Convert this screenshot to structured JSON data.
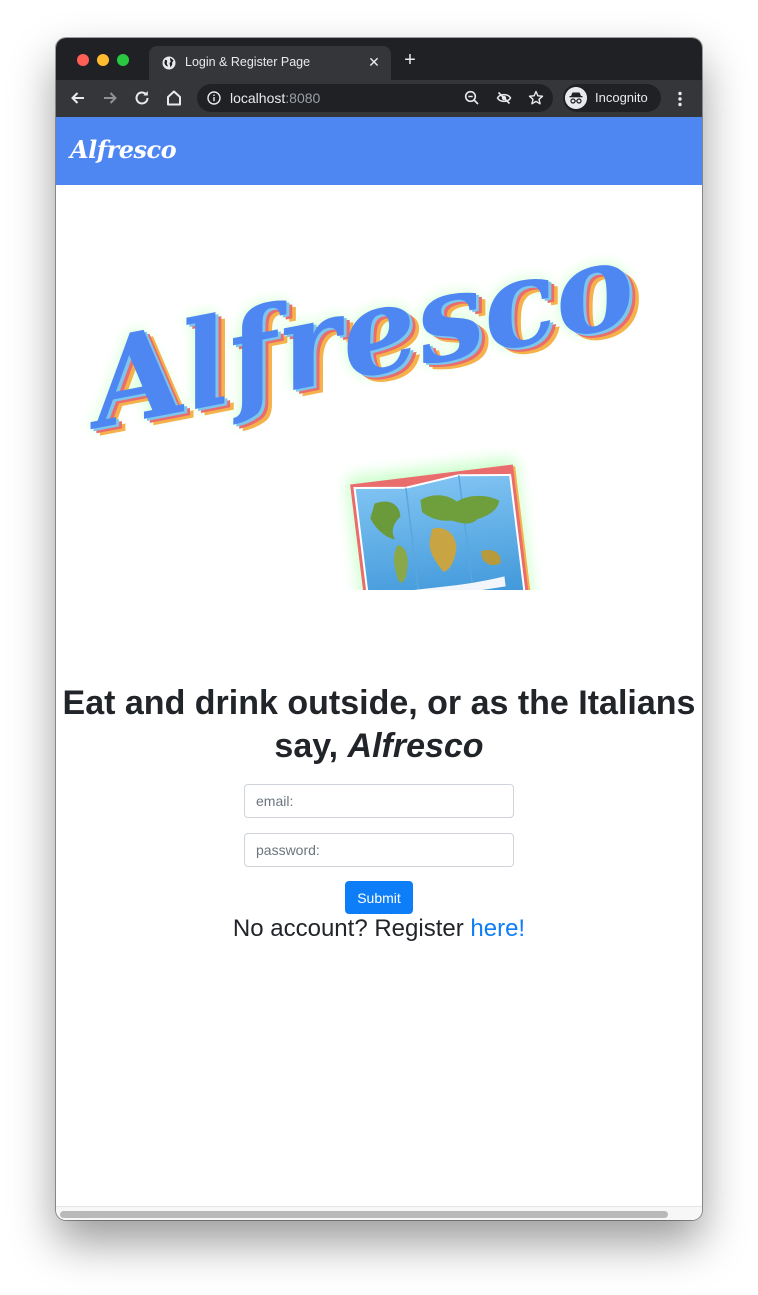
{
  "browser": {
    "tab_title": "Login & Register Page",
    "tab_close": "✕",
    "new_tab": "+",
    "url_host": "localhost",
    "url_port": ":8080",
    "incognito_label": "Incognito",
    "icons": [
      "back-arrow-icon",
      "forward-arrow-icon",
      "reload-icon",
      "home-icon",
      "info-icon",
      "zoom-out-icon",
      "eye-off-icon",
      "star-icon",
      "incognito-icon",
      "more-vert-icon",
      "globe-icon"
    ]
  },
  "navbar": {
    "brand": "Alfresco",
    "background": "#4f87f2"
  },
  "hero": {
    "wordmark": "Alfresco",
    "wordmark_color": "#4f87f2",
    "picture": "world-map"
  },
  "main": {
    "headline_prefix": "Eat and drink outside, or as the Italians say,",
    "headline_emphasis": "Alfresco",
    "email_placeholder": "email:",
    "password_placeholder": "password:",
    "submit_label": "Submit",
    "register_prompt": "No account? Register",
    "register_link": "here!"
  },
  "colors": {
    "primary": "#0d7ef7",
    "text": "#212529"
  }
}
